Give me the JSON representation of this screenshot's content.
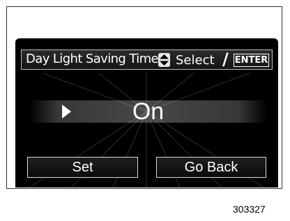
{
  "header": {
    "title": "Day Light Saving Time",
    "select_label": "Select",
    "separator": "/",
    "enter_label": "ENTER"
  },
  "option": {
    "value": "On"
  },
  "buttons": {
    "set_label": "Set",
    "back_label": "Go Back"
  },
  "figure_number": "303327",
  "icons": {
    "updown": "up-down-arrow-icon",
    "pointer": "selection-pointer-icon"
  }
}
